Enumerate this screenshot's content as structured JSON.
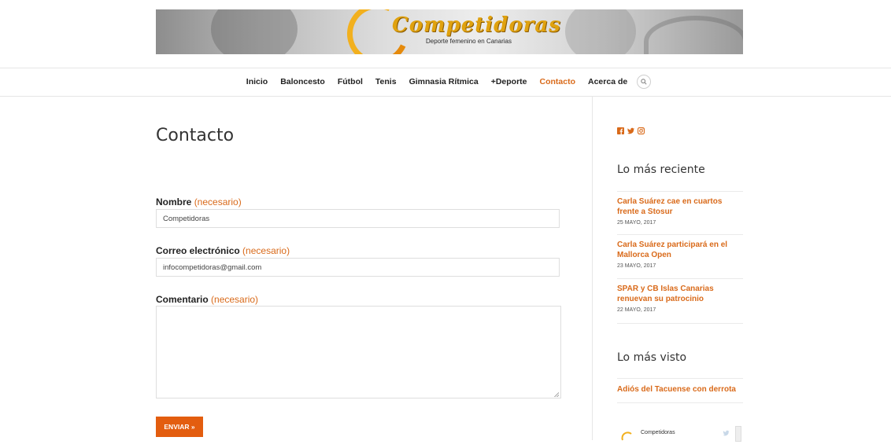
{
  "banner": {
    "logo_text": "Competidoras",
    "tagline": "Deporte femenino en Canarias"
  },
  "nav": {
    "items": [
      {
        "label": "Inicio"
      },
      {
        "label": "Baloncesto"
      },
      {
        "label": "Fútbol"
      },
      {
        "label": "Tenis"
      },
      {
        "label": "Gimnasia Rítmica"
      },
      {
        "label": "+Deporte"
      },
      {
        "label": "Contacto",
        "active": true
      },
      {
        "label": "Acerca de"
      }
    ],
    "search_icon": "search-icon"
  },
  "main": {
    "title": "Contacto",
    "form": {
      "required_text": "(necesario)",
      "name_label": "Nombre",
      "name_value": "Competidoras",
      "email_label": "Correo electrónico",
      "email_value": "infocompetidoras@gmail.com",
      "comment_label": "Comentario",
      "comment_value": "",
      "submit_label": "ENVIAR »"
    }
  },
  "sidebar": {
    "social_icons": [
      "facebook-icon",
      "twitter-icon",
      "instagram-icon"
    ],
    "recent_heading": "Lo más reciente",
    "recent_posts": [
      {
        "title": "Carla Suárez cae en cuartos frente a Stosur",
        "date": "25 MAYO, 2017"
      },
      {
        "title": "Carla Suárez participará en el Mallorca Open",
        "date": "23 MAYO, 2017"
      },
      {
        "title": "SPAR y CB Islas Canarias renuevan su patrocinio",
        "date": "22 MAYO, 2017"
      }
    ],
    "popular_heading": "Lo más visto",
    "popular_posts": [
      {
        "title": "Adiós del Tacuense con derrota"
      }
    ],
    "widget_name": "Competidoras"
  },
  "colors": {
    "accent": "#d96a1a",
    "button": "#e35d0f"
  }
}
